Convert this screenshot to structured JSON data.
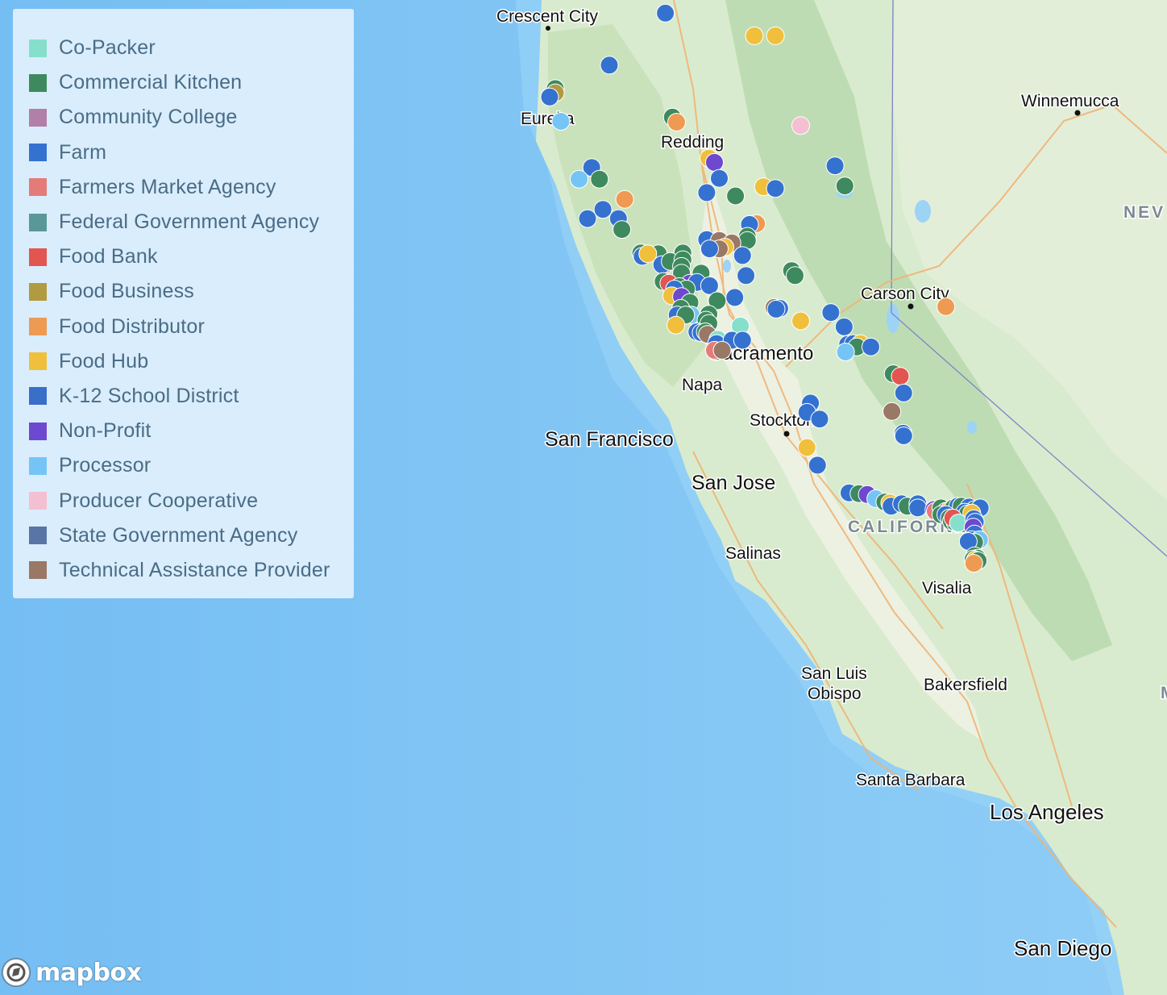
{
  "legend": {
    "items": [
      {
        "label": "Co-Packer",
        "color": "#86dfcb"
      },
      {
        "label": "Commercial Kitchen",
        "color": "#3e8a5e"
      },
      {
        "label": "Community College",
        "color": "#b27fa8"
      },
      {
        "label": "Farm",
        "color": "#3572d0"
      },
      {
        "label": "Farmers Market Agency",
        "color": "#e57b78"
      },
      {
        "label": "Federal Government Agency",
        "color": "#5a9898"
      },
      {
        "label": "Food Bank",
        "color": "#e35551"
      },
      {
        "label": "Food Business",
        "color": "#b19a40"
      },
      {
        "label": "Food Distributor",
        "color": "#ef9a52"
      },
      {
        "label": "Food Hub",
        "color": "#f0bf3c"
      },
      {
        "label": "K-12 School District",
        "color": "#3a6fc9"
      },
      {
        "label": "Non-Profit",
        "color": "#6e48cf"
      },
      {
        "label": "Processor",
        "color": "#74c5f5"
      },
      {
        "label": "Producer Cooperative",
        "color": "#f3bfd1"
      },
      {
        "label": "State Government Agency",
        "color": "#5876a5"
      },
      {
        "label": "Technical Assistance Provider",
        "color": "#9a7866"
      }
    ]
  },
  "map_labels": {
    "crescent_city": "Crescent City",
    "eureka": "Eureka",
    "redding": "Redding",
    "winnemucca": "Winnemucca",
    "nevada": "NEV",
    "carson_city": "Carson City",
    "sacramento": "Sacramento",
    "napa": "Napa",
    "stockton": "Stockton",
    "san_francisco": "San Francisco",
    "san_jose": "San Jose",
    "california": "CALIFORNIA",
    "salinas": "Salinas",
    "visalia": "Visalia",
    "bakersfield": "Bakersfield",
    "san_luis_obispo": "San Luis",
    "obispo": "Obispo",
    "santa_barbara": "Santa Barbara",
    "los_angeles": "Los Angeles",
    "san_diego": "San Diego",
    "m_cut": "M"
  },
  "attribution": {
    "logo_text": "mapbox"
  },
  "markers": [
    {
      "cat": "Farm",
      "lon": -122.55,
      "lat": 41.72
    },
    {
      "cat": "Food Hub",
      "lon": -121.28,
      "lat": 41.45
    },
    {
      "cat": "Food Hub",
      "lon": -120.98,
      "lat": 41.45
    },
    {
      "cat": "Farm",
      "lon": -123.35,
      "lat": 41.1
    },
    {
      "cat": "Commercial Kitchen",
      "lon": -124.12,
      "lat": 40.82
    },
    {
      "cat": "Food Business",
      "lon": -124.12,
      "lat": 40.77
    },
    {
      "cat": "Farm",
      "lon": -124.2,
      "lat": 40.72
    },
    {
      "cat": "Processor",
      "lon": -124.04,
      "lat": 40.43
    },
    {
      "cat": "Commercial Kitchen",
      "lon": -122.45,
      "lat": 40.48
    },
    {
      "cat": "Food Distributor",
      "lon": -122.39,
      "lat": 40.42
    },
    {
      "cat": "Producer Cooperative",
      "lon": -120.62,
      "lat": 40.38
    },
    {
      "cat": "Food Hub",
      "lon": -121.93,
      "lat": 39.99
    },
    {
      "cat": "Non-Profit",
      "lon": -121.85,
      "lat": 39.94
    },
    {
      "cat": "Farm",
      "lon": -121.78,
      "lat": 39.75
    },
    {
      "cat": "Food Hub",
      "lon": -121.15,
      "lat": 39.65
    },
    {
      "cat": "Farm",
      "lon": -120.98,
      "lat": 39.63
    },
    {
      "cat": "Farm",
      "lon": -121.96,
      "lat": 39.58
    },
    {
      "cat": "Commercial Kitchen",
      "lon": -121.55,
      "lat": 39.54
    },
    {
      "cat": "Farm",
      "lon": -120.13,
      "lat": 39.9
    },
    {
      "cat": "Commercial Kitchen",
      "lon": -119.99,
      "lat": 39.66
    },
    {
      "cat": "Farm",
      "lon": -123.6,
      "lat": 39.88
    },
    {
      "cat": "Commercial Kitchen",
      "lon": -123.49,
      "lat": 39.74
    },
    {
      "cat": "Processor",
      "lon": -123.78,
      "lat": 39.74
    },
    {
      "cat": "Food Distributor",
      "lon": -123.13,
      "lat": 39.5
    },
    {
      "cat": "Farm",
      "lon": -123.44,
      "lat": 39.38
    },
    {
      "cat": "Farm",
      "lon": -123.66,
      "lat": 39.27
    },
    {
      "cat": "Farm",
      "lon": -123.22,
      "lat": 39.27
    },
    {
      "cat": "Commercial Kitchen",
      "lon": -123.17,
      "lat": 39.14
    },
    {
      "cat": "Farm",
      "lon": -121.3,
      "lat": 39.2
    },
    {
      "cat": "Food Distributor",
      "lon": -121.25,
      "lat": 39.21
    },
    {
      "cat": "Farm",
      "lon": -121.35,
      "lat": 39.2
    },
    {
      "cat": "Commercial Kitchen",
      "lon": -121.38,
      "lat": 39.06
    },
    {
      "cat": "Commercial Kitchen",
      "lon": -121.38,
      "lat": 39.01
    },
    {
      "cat": "Farm",
      "lon": -121.96,
      "lat": 39.02
    },
    {
      "cat": "Technical Assistance Provider",
      "lon": -121.78,
      "lat": 39.01
    },
    {
      "cat": "Technical Assistance Provider",
      "lon": -121.6,
      "lat": 38.98
    },
    {
      "cat": "Food Hub",
      "lon": -121.7,
      "lat": 38.93
    },
    {
      "cat": "Technical Assistance Provider",
      "lon": -121.78,
      "lat": 38.91
    },
    {
      "cat": "Farm",
      "lon": -121.92,
      "lat": 38.91
    },
    {
      "cat": "Farm",
      "lon": -121.45,
      "lat": 38.83
    },
    {
      "cat": "Commercial Kitchen",
      "lon": -122.9,
      "lat": 38.86
    },
    {
      "cat": "Farm",
      "lon": -122.88,
      "lat": 38.82
    },
    {
      "cat": "Commercial Kitchen",
      "lon": -122.65,
      "lat": 38.85
    },
    {
      "cat": "Food Hub",
      "lon": -122.8,
      "lat": 38.85
    },
    {
      "cat": "Commercial Kitchen",
      "lon": -122.3,
      "lat": 38.86
    },
    {
      "cat": "Food Distributor",
      "lon": -122.56,
      "lat": 38.72
    },
    {
      "cat": "Farm",
      "lon": -122.6,
      "lat": 38.72
    },
    {
      "cat": "Commercial Kitchen",
      "lon": -122.48,
      "lat": 38.76
    },
    {
      "cat": "Commercial Kitchen",
      "lon": -122.3,
      "lat": 38.78
    },
    {
      "cat": "Commercial Kitchen",
      "lon": -122.32,
      "lat": 38.7
    },
    {
      "cat": "Commercial Kitchen",
      "lon": -122.32,
      "lat": 38.62
    },
    {
      "cat": "Commercial Kitchen",
      "lon": -122.04,
      "lat": 38.62
    },
    {
      "cat": "Farm",
      "lon": -121.4,
      "lat": 38.59
    },
    {
      "cat": "Commercial Kitchen",
      "lon": -120.75,
      "lat": 38.65
    },
    {
      "cat": "Commercial Kitchen",
      "lon": -120.7,
      "lat": 38.59
    },
    {
      "cat": "Commercial Kitchen",
      "lon": -122.58,
      "lat": 38.52
    },
    {
      "cat": "Food Bank",
      "lon": -122.5,
      "lat": 38.5
    },
    {
      "cat": "Non-Profit",
      "lon": -122.2,
      "lat": 38.5
    },
    {
      "cat": "Farm",
      "lon": -122.1,
      "lat": 38.51
    },
    {
      "cat": "Farm",
      "lon": -121.92,
      "lat": 38.47
    },
    {
      "cat": "Commercial Kitchen",
      "lon": -122.35,
      "lat": 38.46
    },
    {
      "cat": "Commercial Kitchen",
      "lon": -122.25,
      "lat": 38.43
    },
    {
      "cat": "Farm",
      "lon": -122.42,
      "lat": 38.43
    },
    {
      "cat": "Food Hub",
      "lon": -122.46,
      "lat": 38.35
    },
    {
      "cat": "Non-Profit",
      "lon": -122.32,
      "lat": 38.34
    },
    {
      "cat": "Commercial Kitchen",
      "lon": -122.2,
      "lat": 38.27
    },
    {
      "cat": "Commercial Kitchen",
      "lon": -121.81,
      "lat": 38.29
    },
    {
      "cat": "Farm",
      "lon": -121.56,
      "lat": 38.33
    },
    {
      "cat": "Commercial Kitchen",
      "lon": -122.33,
      "lat": 38.2
    },
    {
      "cat": "Farm",
      "lon": -122.38,
      "lat": 38.12
    },
    {
      "cat": "Processor",
      "lon": -122.18,
      "lat": 38.12
    },
    {
      "cat": "Commercial Kitchen",
      "lon": -122.26,
      "lat": 38.12
    },
    {
      "cat": "Commercial Kitchen",
      "lon": -121.93,
      "lat": 38.13
    },
    {
      "cat": "Commercial Kitchen",
      "lon": -121.97,
      "lat": 38.06
    },
    {
      "cat": "Commercial Kitchen",
      "lon": -121.93,
      "lat": 38.02
    },
    {
      "cat": "Technical Assistance Provider",
      "lon": -121.0,
      "lat": 38.21
    },
    {
      "cat": "Farm",
      "lon": -120.92,
      "lat": 38.2
    },
    {
      "cat": "Farm",
      "lon": -120.97,
      "lat": 38.19
    },
    {
      "cat": "Food Hub",
      "lon": -120.62,
      "lat": 38.05
    },
    {
      "cat": "Food Hub",
      "lon": -122.4,
      "lat": 38.0
    },
    {
      "cat": "Farm",
      "lon": -122.1,
      "lat": 37.92
    },
    {
      "cat": "Farm",
      "lon": -122.04,
      "lat": 37.91
    },
    {
      "cat": "Commercial Kitchen",
      "lon": -121.98,
      "lat": 37.92
    },
    {
      "cat": "Technical Assistance Provider",
      "lon": -121.95,
      "lat": 37.89
    },
    {
      "cat": "Co-Packer",
      "lon": -121.48,
      "lat": 37.99
    },
    {
      "cat": "Co-Packer",
      "lon": -121.8,
      "lat": 37.83
    },
    {
      "cat": "Farm",
      "lon": -121.82,
      "lat": 37.78
    },
    {
      "cat": "Farm",
      "lon": -121.6,
      "lat": 37.82
    },
    {
      "cat": "Farm",
      "lon": -121.45,
      "lat": 37.82
    },
    {
      "cat": "Farmers Market Agency",
      "lon": -121.85,
      "lat": 37.7
    },
    {
      "cat": "Technical Assistance Provider",
      "lon": -121.74,
      "lat": 37.7
    },
    {
      "cat": "Farm",
      "lon": -120.19,
      "lat": 38.15
    },
    {
      "cat": "Food Distributor",
      "lon": -118.55,
      "lat": 38.22
    },
    {
      "cat": "Farm",
      "lon": -120.0,
      "lat": 37.98
    },
    {
      "cat": "Farm",
      "lon": -119.95,
      "lat": 37.77
    },
    {
      "cat": "Farm",
      "lon": -119.87,
      "lat": 37.78
    },
    {
      "cat": "Food Hub",
      "lon": -119.77,
      "lat": 37.78
    },
    {
      "cat": "Commercial Kitchen",
      "lon": -119.82,
      "lat": 37.74
    },
    {
      "cat": "Farm",
      "lon": -119.62,
      "lat": 37.74
    },
    {
      "cat": "Processor",
      "lon": -119.98,
      "lat": 37.68
    },
    {
      "cat": "Commercial Kitchen",
      "lon": -119.3,
      "lat": 37.42
    },
    {
      "cat": "Food Bank",
      "lon": -119.2,
      "lat": 37.39
    },
    {
      "cat": "Farm",
      "lon": -119.15,
      "lat": 37.19
    },
    {
      "cat": "Technical Assistance Provider",
      "lon": -119.32,
      "lat": 36.97
    },
    {
      "cat": "Farm",
      "lon": -119.16,
      "lat": 36.71
    },
    {
      "cat": "Farm",
      "lon": -119.15,
      "lat": 36.68
    },
    {
      "cat": "Farm",
      "lon": -120.48,
      "lat": 37.07
    },
    {
      "cat": "Farm",
      "lon": -120.53,
      "lat": 36.96
    },
    {
      "cat": "Farm",
      "lon": -120.35,
      "lat": 36.88
    },
    {
      "cat": "Food Hub",
      "lon": -120.53,
      "lat": 36.54
    },
    {
      "cat": "Farm",
      "lon": -120.38,
      "lat": 36.33
    },
    {
      "cat": "Farm",
      "lon": -119.93,
      "lat": 36.0
    },
    {
      "cat": "Commercial Kitchen",
      "lon": -119.79,
      "lat": 35.99
    },
    {
      "cat": "Non-Profit",
      "lon": -119.67,
      "lat": 35.98
    },
    {
      "cat": "Processor",
      "lon": -119.55,
      "lat": 35.93
    },
    {
      "cat": "Commercial Kitchen",
      "lon": -119.42,
      "lat": 35.89
    },
    {
      "cat": "Food Hub",
      "lon": -119.35,
      "lat": 35.88
    },
    {
      "cat": "Farm",
      "lon": -119.33,
      "lat": 35.84
    },
    {
      "cat": "Farm",
      "lon": -119.18,
      "lat": 35.87
    },
    {
      "cat": "Commercial Kitchen",
      "lon": -119.1,
      "lat": 35.84
    },
    {
      "cat": "Farm",
      "lon": -118.95,
      "lat": 35.87
    },
    {
      "cat": "Farm",
      "lon": -118.95,
      "lat": 35.82
    },
    {
      "cat": "Non-Profit",
      "lon": -118.72,
      "lat": 35.8
    },
    {
      "cat": "Farmers Market Agency",
      "lon": -118.7,
      "lat": 35.78
    },
    {
      "cat": "Commercial Kitchen",
      "lon": -118.62,
      "lat": 35.82
    },
    {
      "cat": "Food Bank",
      "lon": -118.55,
      "lat": 35.78
    },
    {
      "cat": "Food Hub",
      "lon": -118.5,
      "lat": 35.79
    },
    {
      "cat": "Commercial Kitchen",
      "lon": -118.44,
      "lat": 35.82
    },
    {
      "cat": "Farm",
      "lon": -118.38,
      "lat": 35.84
    },
    {
      "cat": "Commercial Kitchen",
      "lon": -118.33,
      "lat": 35.84
    },
    {
      "cat": "Farm",
      "lon": -118.22,
      "lat": 35.83
    },
    {
      "cat": "Commercial Kitchen",
      "lon": -118.14,
      "lat": 35.8
    },
    {
      "cat": "Farm",
      "lon": -118.06,
      "lat": 35.82
    },
    {
      "cat": "Farm",
      "lon": -118.28,
      "lat": 35.77
    },
    {
      "cat": "Commercial Kitchen",
      "lon": -118.24,
      "lat": 35.75
    },
    {
      "cat": "Food Hub",
      "lon": -118.18,
      "lat": 35.76
    },
    {
      "cat": "Commercial Kitchen",
      "lon": -118.62,
      "lat": 35.74
    },
    {
      "cat": "Farm",
      "lon": -118.55,
      "lat": 35.74
    },
    {
      "cat": "Commercial Kitchen",
      "lon": -118.5,
      "lat": 35.7
    },
    {
      "cat": "Commercial Kitchen",
      "lon": -118.47,
      "lat": 35.66
    },
    {
      "cat": "Commercial Kitchen",
      "lon": -118.42,
      "lat": 35.65
    },
    {
      "cat": "Food Bank",
      "lon": -118.45,
      "lat": 35.7
    },
    {
      "cat": "Co-Packer",
      "lon": -118.37,
      "lat": 35.64
    },
    {
      "cat": "Farm",
      "lon": -118.15,
      "lat": 35.69
    },
    {
      "cat": "Farm",
      "lon": -118.13,
      "lat": 35.65
    },
    {
      "cat": "Non-Profit",
      "lon": -118.16,
      "lat": 35.59
    },
    {
      "cat": "Farm",
      "lon": -118.14,
      "lat": 35.51
    },
    {
      "cat": "Farm",
      "lon": -118.18,
      "lat": 35.44
    },
    {
      "cat": "Processor",
      "lon": -118.07,
      "lat": 35.44
    },
    {
      "cat": "Commercial Kitchen",
      "lon": -118.14,
      "lat": 35.41
    },
    {
      "cat": "Farm",
      "lon": -118.23,
      "lat": 35.42
    },
    {
      "cat": "Commercial Kitchen",
      "lon": -118.14,
      "lat": 35.25
    },
    {
      "cat": "Commercial Kitchen",
      "lon": -118.1,
      "lat": 35.22
    },
    {
      "cat": "Commercial Kitchen",
      "lon": -118.16,
      "lat": 35.21
    },
    {
      "cat": "Food Hub",
      "lon": -118.13,
      "lat": 35.2
    },
    {
      "cat": "Commercial Kitchen",
      "lon": -118.09,
      "lat": 35.19
    },
    {
      "cat": "Food Distributor",
      "lon": -118.15,
      "lat": 35.16
    }
  ]
}
